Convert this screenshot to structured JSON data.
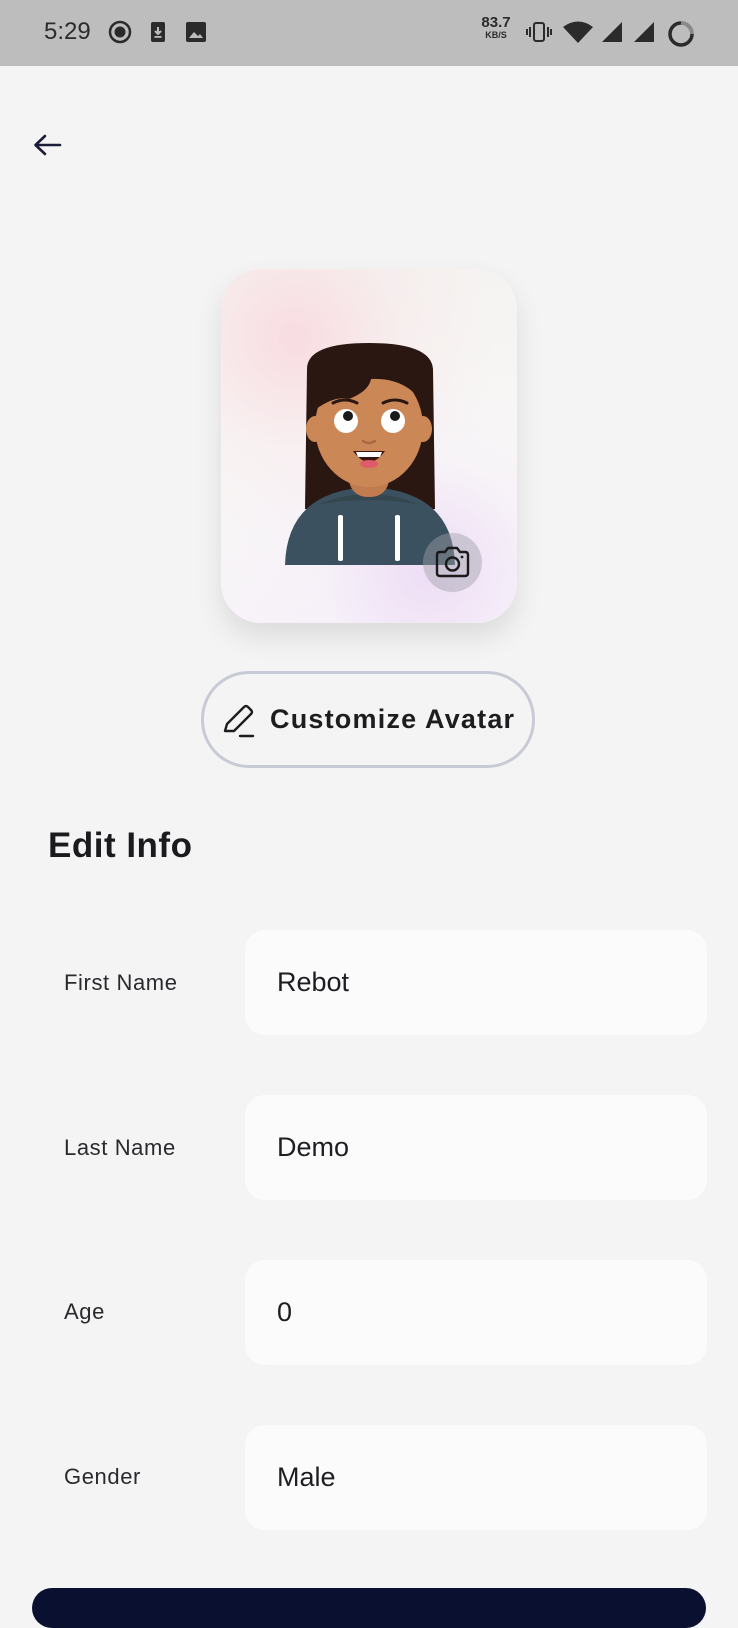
{
  "status_bar": {
    "time": "5:29",
    "net_speed_value": "83.7",
    "net_speed_unit": "KB/S",
    "icons": [
      "record-icon",
      "download-icon",
      "image-icon",
      "vibrate-icon",
      "wifi-icon",
      "signal-icon",
      "signal-icon",
      "loading-icon"
    ]
  },
  "header": {
    "back_icon": "arrow-left-icon"
  },
  "avatar": {
    "camera_icon": "camera-icon"
  },
  "customize_button": {
    "label": "Customize Avatar",
    "icon": "pencil-icon"
  },
  "section_title": "Edit Info",
  "fields": [
    {
      "label": "First Name",
      "value": "Rebot"
    },
    {
      "label": "Last Name",
      "value": "Demo"
    },
    {
      "label": "Age",
      "value": "0"
    },
    {
      "label": "Gender",
      "value": "Male"
    }
  ],
  "colors": {
    "accent_dark": "#0a1030",
    "background": "#f4f4f4",
    "status_bar": "#bdbdbd"
  }
}
